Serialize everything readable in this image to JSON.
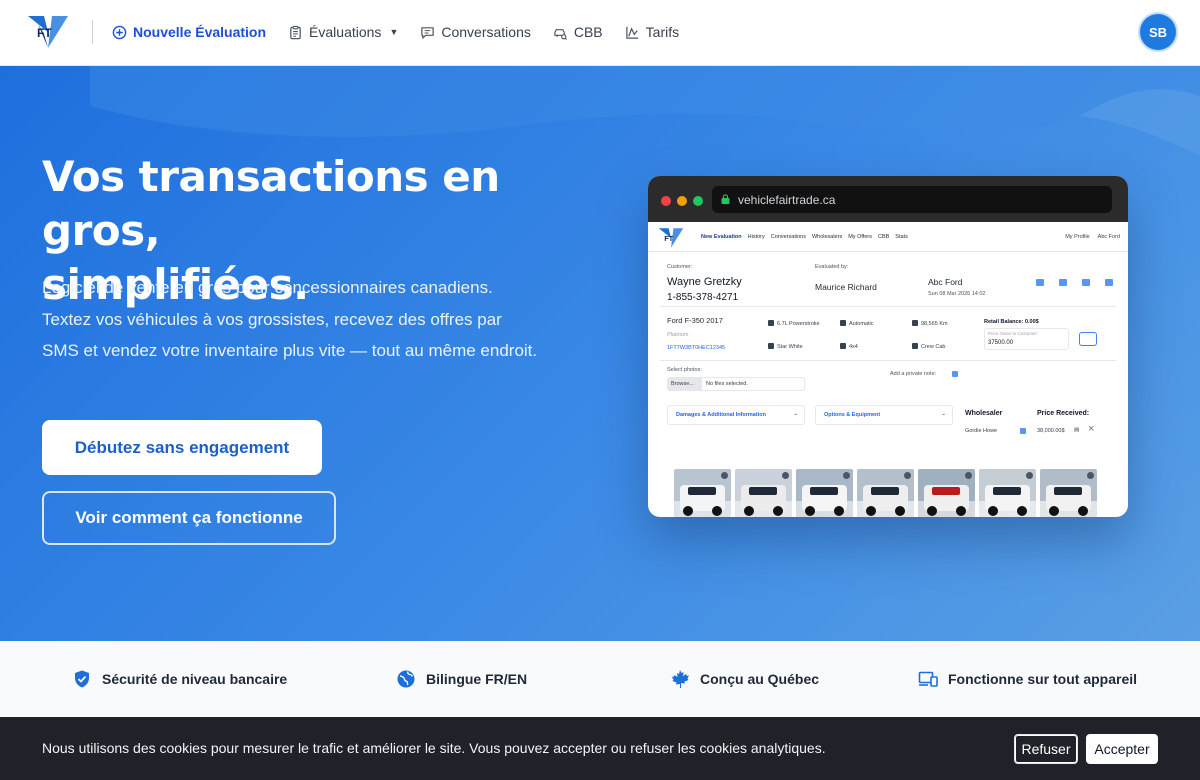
{
  "nav": {
    "new_eval": "Nouvelle Évaluation",
    "evaluations": "Évaluations",
    "conversations": "Conversations",
    "cbb": "CBB",
    "tarifs": "Tarifs",
    "avatar_initials": "SB"
  },
  "hero": {
    "title_line1": "Vos transactions en gros,",
    "title_line2": "simplifiées.",
    "subtitle": "Logiciel de vente en gros pour concessionnaires canadiens. Textez vos véhicules à vos grossistes, recevez des offres par SMS et vendez votre inventaire plus vite — tout au même endroit.",
    "cta_primary": "Débutez sans engagement",
    "cta_secondary": "Voir comment ça fonctionne"
  },
  "mockup": {
    "url": "vehiclefairtrade.ca",
    "nav_links": [
      "New Evaluation",
      "History",
      "Conversations",
      "Wholesalers",
      "My Offers",
      "CBB",
      "Stats"
    ],
    "nav_right": [
      "My Profile",
      "Abc Ford"
    ],
    "customer_label": "Customer:",
    "customer_name": "Wayne Gretzky",
    "customer_phone": "1-855-378-4271",
    "evaluated_label": "Evaluated by:",
    "evaluator": "Maurice Richard",
    "dealer": "Abc Ford",
    "date": "Sun 08 Mar 2026 14:02",
    "vehicle": "Ford F-350 2017",
    "trim": "Platinum",
    "vin": "1FT7W3BT0HEC12345",
    "engine": "6.7L Powerstroke",
    "transmission": "Automatic",
    "mileage": "98,565 Km",
    "color": "Star White",
    "drive": "4x4",
    "cab": "Crew Cab",
    "retail_label": "Retail Balance: 0.00$",
    "price_label": "Price Given to Customer",
    "price_value": "37500.00",
    "photos_label": "Select photos:",
    "browse": "Browse...",
    "no_files": "No files selected.",
    "private_note": "Add a private note:",
    "damages": "Damages & Additional Information",
    "options": "Options & Equipment",
    "wholesaler_hdr": "Wholesaler",
    "price_received_hdr": "Price Received:",
    "wholesaler_name": "Gordie Howe",
    "price_received": "38,000.00$"
  },
  "features": [
    {
      "label": "Sécurité de niveau bancaire",
      "icon": "shield-icon"
    },
    {
      "label": "Bilingue FR/EN",
      "icon": "globe-icon"
    },
    {
      "label": "Conçu au Québec",
      "icon": "maple-leaf-icon"
    },
    {
      "label": "Fonctionne sur tout appareil",
      "icon": "devices-icon"
    }
  ],
  "cookie": {
    "text": "Nous utilisons des cookies pour mesurer le trafic et améliorer le site. Vous pouvez accepter ou refuser les cookies analytiques.",
    "refuse": "Refuser",
    "accept": "Accepter"
  },
  "colors": {
    "brand_blue": "#1d6fdc",
    "hero_start": "#1e6fde",
    "hero_end": "#5a9fe4",
    "cookie_bg": "#1f2228"
  }
}
